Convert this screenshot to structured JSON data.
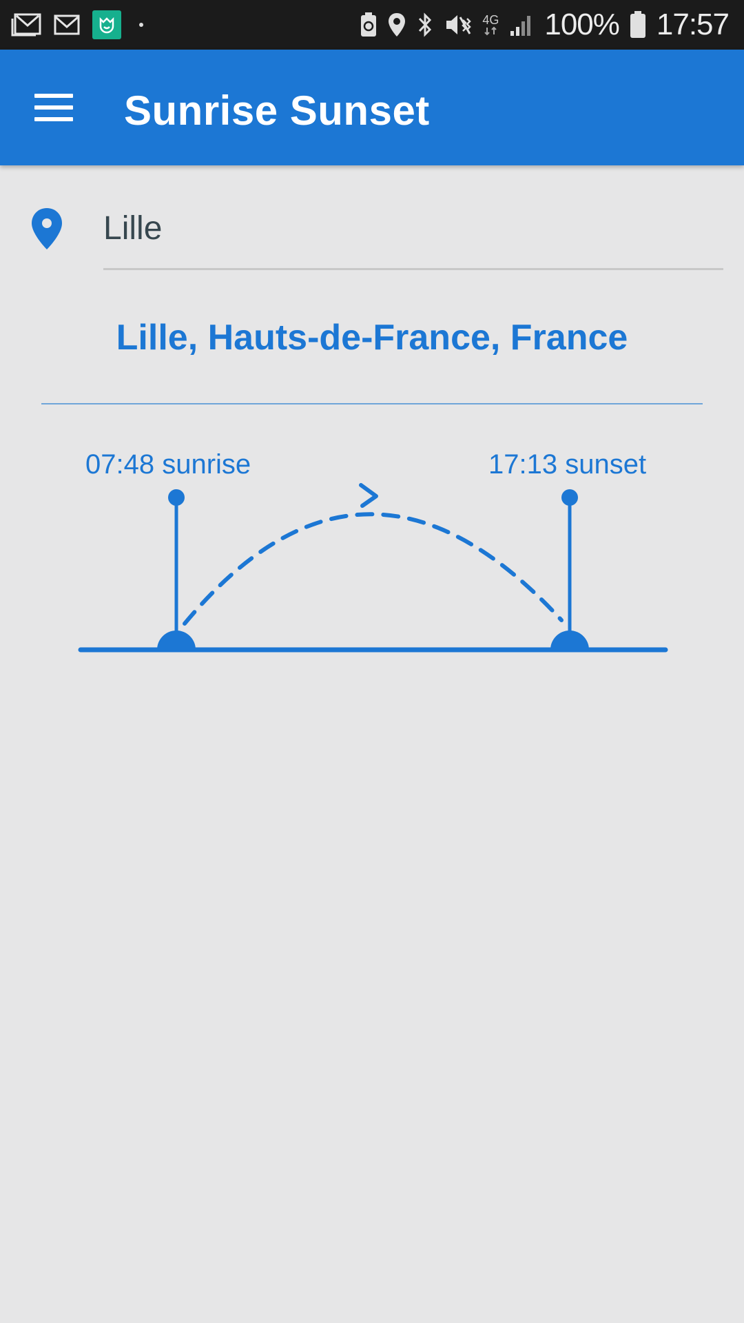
{
  "status_bar": {
    "battery": "100%",
    "time": "17:57",
    "network": "4G",
    "icons": [
      "gmail-photo-icon",
      "gmail-icon",
      "mi-fit-icon",
      "battery-saver-icon",
      "location-icon",
      "bluetooth-icon",
      "vibrate-mute-icon",
      "signal-icon",
      "battery-icon"
    ]
  },
  "app_bar": {
    "title": "Sunrise Sunset",
    "menu_icon": "hamburger-menu-icon",
    "color": "#1c77d4"
  },
  "location": {
    "icon": "location-pin-icon",
    "value": "Lille"
  },
  "place": {
    "full_name": "Lille, Hauts-de-France, France"
  },
  "sun": {
    "sunrise_label": "07:48 sunrise",
    "sunset_label": "17:13 sunset",
    "accent": "#1c77d4"
  }
}
